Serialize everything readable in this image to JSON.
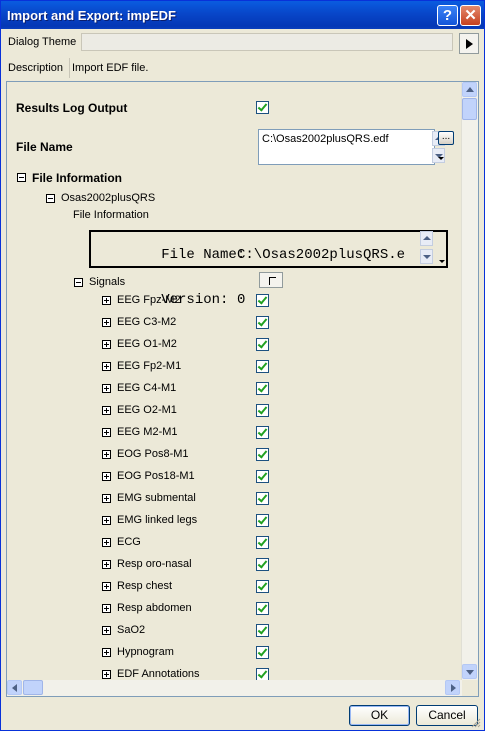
{
  "window": {
    "title": "Import and Export: impEDF",
    "help_glyph": "?",
    "close_glyph": "✕"
  },
  "dialog_theme": {
    "label": "Dialog Theme",
    "value": ""
  },
  "description": {
    "label": "Description",
    "value": "Import EDF file."
  },
  "results_log": {
    "label": "Results Log Output",
    "checked": true
  },
  "file_name": {
    "label": "File Name",
    "value": "C:\\Osas2002plusQRS.edf",
    "browse_glyph": "..."
  },
  "file_information": {
    "label": "File Information",
    "node": "Osas2002plusQRS",
    "sub_label": "File Information",
    "lines": [
      {
        "key": "File Name:",
        "value": "C:\\Osas2002plusQRS.e"
      },
      {
        "key": "Version:",
        "value": "0"
      }
    ]
  },
  "signals": {
    "label": "Signals",
    "items": [
      {
        "label": "EEG Fpz-M2",
        "checked": true
      },
      {
        "label": "EEG C3-M2",
        "checked": true
      },
      {
        "label": "EEG O1-M2",
        "checked": true
      },
      {
        "label": "EEG Fp2-M1",
        "checked": true
      },
      {
        "label": "EEG C4-M1",
        "checked": true
      },
      {
        "label": "EEG O2-M1",
        "checked": true
      },
      {
        "label": "EEG M2-M1",
        "checked": true
      },
      {
        "label": "EOG Pos8-M1",
        "checked": true
      },
      {
        "label": "EOG Pos18-M1",
        "checked": true
      },
      {
        "label": "EMG submental",
        "checked": true
      },
      {
        "label": "EMG linked legs",
        "checked": true
      },
      {
        "label": "ECG",
        "checked": true
      },
      {
        "label": "Resp oro-nasal",
        "checked": true
      },
      {
        "label": "Resp chest",
        "checked": true
      },
      {
        "label": "Resp abdomen",
        "checked": true
      },
      {
        "label": "SaO2",
        "checked": true
      },
      {
        "label": "Hypnogram",
        "checked": true
      },
      {
        "label": "EDF Annotations",
        "checked": true
      }
    ]
  },
  "buttons": {
    "ok": "OK",
    "cancel": "Cancel"
  }
}
